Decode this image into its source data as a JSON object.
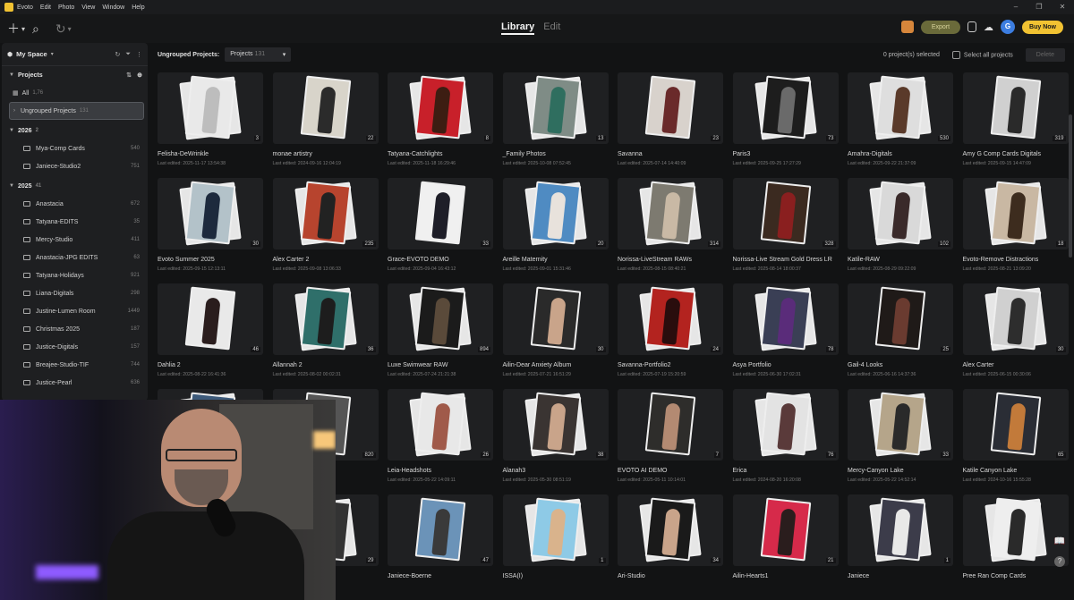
{
  "menubar": {
    "app": "Evoto",
    "items": [
      "Edit",
      "Photo",
      "View",
      "Window",
      "Help"
    ],
    "window_controls": [
      "–",
      "❐",
      "✕"
    ]
  },
  "toolbar": {
    "add_icon": "plus-icon",
    "search_icon": "search-icon",
    "undo_icon": "undo-icon"
  },
  "modes": {
    "library": "Library",
    "edit": "Edit"
  },
  "right": {
    "export": "Export",
    "avatar": "G",
    "buy": "Buy Now"
  },
  "sidebar": {
    "title": "My Space",
    "projects_label": "Projects",
    "all": {
      "label": "All",
      "count": "1,76"
    },
    "ungrouped": {
      "label": "Ungrouped Projects",
      "count": "131"
    },
    "groups": [
      {
        "year": "2026",
        "count": "2",
        "items": [
          {
            "label": "Mya-Comp Cards",
            "count": "540"
          },
          {
            "label": "Janiece-Studio2",
            "count": "751"
          }
        ]
      },
      {
        "year": "2025",
        "count": "41",
        "items": [
          {
            "label": "Anastacia",
            "count": "672"
          },
          {
            "label": "Tatyana-EDITS",
            "count": "35"
          },
          {
            "label": "Mercy-Studio",
            "count": "411"
          },
          {
            "label": "Anastacia-JPG EDITS",
            "count": "63"
          },
          {
            "label": "Tatyana-Holidays",
            "count": "921"
          },
          {
            "label": "Liana-Digitals",
            "count": "298"
          },
          {
            "label": "Justine-Lumen Room",
            "count": "1449"
          },
          {
            "label": "Christmas 2025",
            "count": "187"
          },
          {
            "label": "Justice-Digitals",
            "count": "157"
          },
          {
            "label": "Breajee-Studio-TIF",
            "count": "744"
          },
          {
            "label": "Justice-Pearl",
            "count": "636"
          }
        ]
      }
    ]
  },
  "main": {
    "heading": "Ungrouped Projects:",
    "selector": "Projects",
    "selector_count": "131",
    "selected": "0 project(s) selected",
    "select_all": "Select all projects",
    "delete": "Delete"
  },
  "cards": [
    {
      "name": "Felisha-DeWrinkle",
      "date": "Last edited: 2025-11-17 13:54:38",
      "count": "3",
      "bg": "#e9e9e9",
      "fg": "#bdbdbd"
    },
    {
      "name": "monae artistry",
      "date": "Last edited: 2024-09-16 12:04:19",
      "count": "22",
      "bg": "#d8d4ca",
      "fg": "#2b2b2b"
    },
    {
      "name": "Tatyana-Catchlights",
      "date": "Last edited: 2025-11-18 16:29:46",
      "count": "8",
      "bg": "#c8202a",
      "fg": "#3d1d12"
    },
    {
      "name": "_Family Photos",
      "date": "Last edited: 2025-10-08 07:52:45",
      "count": "13",
      "bg": "#7f8c86",
      "fg": "#2f6e5f"
    },
    {
      "name": "Savanna",
      "date": "Last edited: 2025-07-14 14:40:09",
      "count": "23",
      "bg": "#d8d2cc",
      "fg": "#6a2a2a"
    },
    {
      "name": "Paris3",
      "date": "Last edited: 2025-09-25 17:27:29",
      "count": "73",
      "bg": "#1d1d1d",
      "fg": "#6a6a6a"
    },
    {
      "name": "Amahra-Digitals",
      "date": "Last edited: 2025-09-22 21:37:09",
      "count": "530",
      "bg": "#dedede",
      "fg": "#5a3a2a"
    },
    {
      "name": "Amy G Comp Cards Digitals",
      "date": "Last edited: 2025-09-15 14:47:09",
      "count": "319",
      "bg": "#d0d0d0",
      "fg": "#2a2a2a"
    },
    {
      "name": "Evoto Summer 2025",
      "date": "Last edited: 2025-09-15 12:13:11",
      "count": "30",
      "bg": "#b3c2c9",
      "fg": "#1d2a3d"
    },
    {
      "name": "Alex Carter 2",
      "date": "Last edited: 2025-09-08 13:06:33",
      "count": "235",
      "bg": "#b7442e",
      "fg": "#222"
    },
    {
      "name": "Grace-EVOTO DEMO",
      "date": "Last edited: 2025-09-04 16:43:12",
      "count": "33",
      "bg": "#f0f0f0",
      "fg": "#1e1e28"
    },
    {
      "name": "Areille Maternity",
      "date": "Last edited: 2025-09-01 15:31:46",
      "count": "20",
      "bg": "#4f8bc2",
      "fg": "#e8e2dc"
    },
    {
      "name": "Norissa-LiveStream RAWs",
      "date": "Last edited: 2025-08-15 08:40:21",
      "count": "314",
      "bg": "#7d7a70",
      "fg": "#c9b9a5"
    },
    {
      "name": "Norissa-Live Stream Gold Dress LR",
      "date": "Last edited: 2025-08-14 18:00:37",
      "count": "328",
      "bg": "#3b2a20",
      "fg": "#8a1f1f"
    },
    {
      "name": "Katile-RAW",
      "date": "Last edited: 2025-08-29 09:22:09",
      "count": "102",
      "bg": "#d9d9d9",
      "fg": "#3a2a2a"
    },
    {
      "name": "Evoto-Remove Distractions",
      "date": "Last edited: 2025-08-21 13:09:20",
      "count": "18",
      "bg": "#c9b8a3",
      "fg": "#3d2c1e"
    },
    {
      "name": "Dahlia 2",
      "date": "Last edited: 2025-08-22 16:41:36",
      "count": "46",
      "bg": "#e9e9e9",
      "fg": "#2a1d1d"
    },
    {
      "name": "Allannah 2",
      "date": "Last edited: 2025-08-02 00:02:31",
      "count": "36",
      "bg": "#2f6f6a",
      "fg": "#1d1d1d"
    },
    {
      "name": "Luxe Swimwear RAW",
      "date": "Last edited: 2025-07-24 21:21:38",
      "count": "894",
      "bg": "#1b1b1b",
      "fg": "#5a4a3a"
    },
    {
      "name": "Ailin-Dear Anxiety Album",
      "date": "Last edited: 2025-07-21 16:51:29",
      "count": "30",
      "bg": "#2a2a2a",
      "fg": "#c9a48a"
    },
    {
      "name": "Savanna-Portfolio2",
      "date": "Last edited: 2025-07-19 15:20:59",
      "count": "24",
      "bg": "#b3231f",
      "fg": "#2a0d0d"
    },
    {
      "name": "Asya Portfolio",
      "date": "Last edited: 2025-06-30 17:02:31",
      "count": "78",
      "bg": "#3a3f55",
      "fg": "#5a2c7a"
    },
    {
      "name": "Gail-4 Looks",
      "date": "Last edited: 2025-06-16 14:37:36",
      "count": "25",
      "bg": "#1f1a18",
      "fg": "#6a3b30"
    },
    {
      "name": "Alex Carter",
      "date": "Last edited: 2025-06-15 00:30:06",
      "count": "30",
      "bg": "#d0d0d0",
      "fg": "#2d2d2d"
    },
    {
      "name": "",
      "date": "",
      "count": "",
      "bg": "#3d5a7a",
      "fg": "#2a2a2a"
    },
    {
      "name": "",
      "date": "",
      "count": "820",
      "bg": "#555",
      "fg": "#333"
    },
    {
      "name": "Leia-Headshots",
      "date": "Last edited: 2025-05-22 14:09:11",
      "count": "26",
      "bg": "#e8e8e8",
      "fg": "#a05a4a"
    },
    {
      "name": "Alanah3",
      "date": "Last edited: 2025-05-30 08:51:19",
      "count": "38",
      "bg": "#3a3432",
      "fg": "#c9a48a"
    },
    {
      "name": "EVOTO AI DEMO",
      "date": "Last edited: 2025-05-11 10:14:01",
      "count": "7",
      "bg": "#2e2d2b",
      "fg": "#b38a72"
    },
    {
      "name": "Erica",
      "date": "Last edited: 2024-08-20 16:20:08",
      "count": "76",
      "bg": "#e3e3e3",
      "fg": "#5a3a3a"
    },
    {
      "name": "Mercy-Canyon Lake",
      "date": "Last edited: 2025-05-22 14:52:14",
      "count": "33",
      "bg": "#b5a58a",
      "fg": "#2a2a2a"
    },
    {
      "name": "Katile Canyon Lake",
      "date": "Last edited: 2024-10-16 15:55:28",
      "count": "65",
      "bg": "#2a2d35",
      "fg": "#c27a3a"
    },
    {
      "name": "",
      "date": "",
      "count": "",
      "bg": "#333",
      "fg": "#222"
    },
    {
      "name": "",
      "date": "",
      "count": "29",
      "bg": "#333",
      "fg": "#222"
    },
    {
      "name": "Janiece-Boerne",
      "date": "",
      "count": "47",
      "bg": "#6b93b8",
      "fg": "#3a3a3a"
    },
    {
      "name": "ISSA(I)",
      "date": "",
      "count": "1",
      "bg": "#8ecae6",
      "fg": "#d9b38c"
    },
    {
      "name": "Ari-Studio",
      "date": "",
      "count": "34",
      "bg": "#1a1a1a",
      "fg": "#c9a48a"
    },
    {
      "name": "Ailin-Hearts1",
      "date": "",
      "count": "21",
      "bg": "#d62a4a",
      "fg": "#2a1d1d"
    },
    {
      "name": "Janiece",
      "date": "",
      "count": "1",
      "bg": "#3c3c4a",
      "fg": "#e8e8e8"
    },
    {
      "name": "Pree Ran Comp Cards",
      "date": "",
      "count": "",
      "bg": "#eeeeee",
      "fg": "#2a2a2a"
    }
  ]
}
